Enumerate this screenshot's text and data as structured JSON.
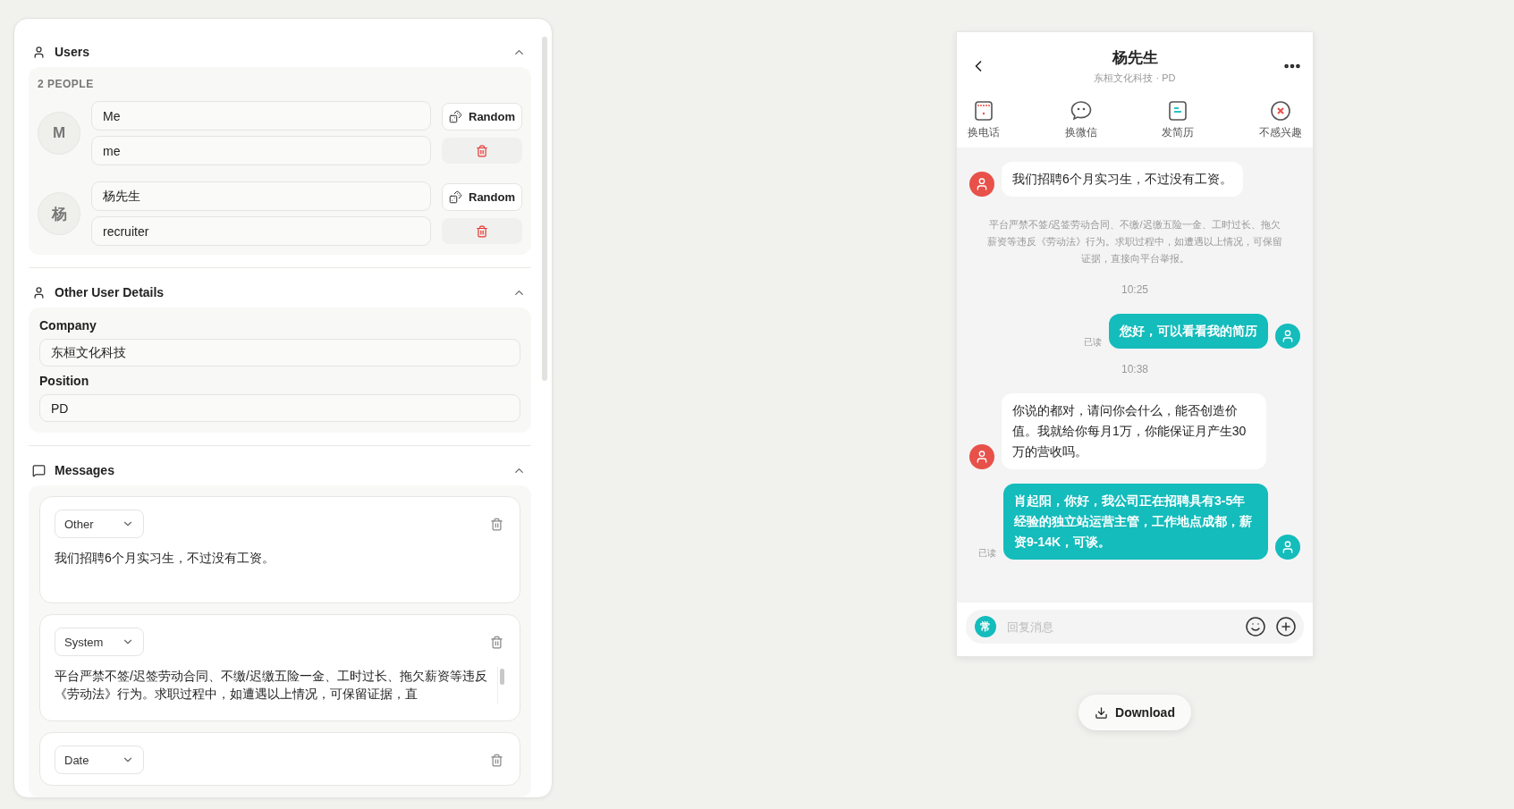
{
  "editor": {
    "users": {
      "title": "Users",
      "expanded": true,
      "count_label": "2 PEOPLE",
      "people": [
        {
          "initial": "M",
          "name": "Me",
          "role": "me",
          "random_label": "Random"
        },
        {
          "initial": "杨",
          "name": "杨先生",
          "role": "recruiter",
          "random_label": "Random"
        }
      ]
    },
    "details": {
      "title": "Other User Details",
      "expanded": true,
      "fields": [
        {
          "label": "Company",
          "value": "东桓文化科技"
        },
        {
          "label": "Position",
          "value": "PD"
        }
      ]
    },
    "messages": {
      "title": "Messages",
      "expanded": true,
      "items": [
        {
          "sender": "Other",
          "text": "我们招聘6个月实习生，不过没有工资。"
        },
        {
          "sender": "System",
          "text": "平台严禁不签/迟签劳动合同、不缴/迟缴五险一金、工时过长、拖欠薪资等违反《劳动法》行为。求职过程中，如遭遇以上情况，可保留证据，直"
        },
        {
          "sender": "Date"
        }
      ]
    }
  },
  "phone": {
    "title": "杨先生",
    "subtitle": "东桓文化科技 · PD",
    "actions": [
      {
        "kind": "phone",
        "label": "换电话"
      },
      {
        "kind": "wechat",
        "label": "换微信"
      },
      {
        "kind": "resume",
        "label": "发简历"
      },
      {
        "kind": "reject",
        "label": "不感兴趣"
      }
    ],
    "chat": [
      {
        "kind": "other",
        "text": "我们招聘6个月实习生，不过没有工资。"
      },
      {
        "kind": "system",
        "text": "平台严禁不签/迟签劳动合同、不缴/迟缴五险一金、工时过长、拖欠薪资等违反《劳动法》行为。求职过程中，如遭遇以上情况，可保留证据，直接向平台举报。"
      },
      {
        "kind": "time",
        "text": "10:25"
      },
      {
        "kind": "me",
        "text": "您好，可以看看我的简历",
        "status": "已读"
      },
      {
        "kind": "time",
        "text": "10:38"
      },
      {
        "kind": "other",
        "text": "你说的都对，请问你会什么，能否创造价值。我就给你每月1万，你能保证月产生30万的营收吗。"
      },
      {
        "kind": "me",
        "text": "肖起阳，你好，我公司正在招聘具有3-5年经验的独立站运营主管，工作地点成都，薪资9-14K，可谈。",
        "status": "已读"
      }
    ],
    "quick_badge": "常",
    "reply_placeholder": "回复消息"
  },
  "download_label": "Download"
}
